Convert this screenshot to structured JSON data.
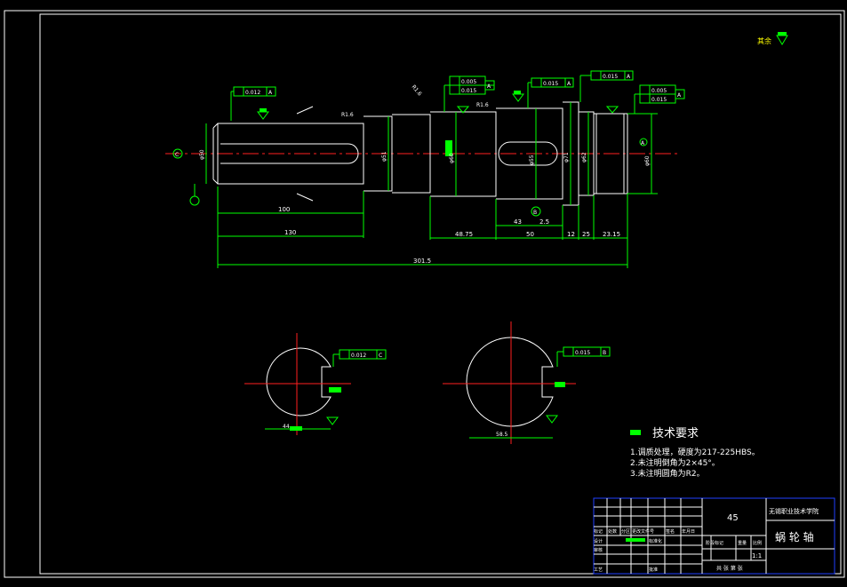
{
  "drawing": {
    "surface_finish_note": "其余",
    "dimensions": {
      "d_100": "100",
      "d_130": "130",
      "d_301_5": "301.5",
      "d_48_75": "48.75",
      "d_50": "50",
      "d_12": "12",
      "d_25_a": "25",
      "d_23_15": "23.15",
      "d_43": "43",
      "d_2_5": "2.5",
      "dia_50": "φ50",
      "dia_51": "φ51",
      "dia_60": "φ60",
      "dia_55": "φ55",
      "dia_71": "φ71",
      "dia_62": "φ62",
      "dia_60b": "φ60",
      "chamfer_1": "R1.6",
      "chamfer_2": "R1.6",
      "chamfer_3": "R1.6",
      "sec1_width": "44",
      "sec2_width": "58.5"
    },
    "tolerances": {
      "fcf1": "0.012",
      "fcf1_datum": "A",
      "fcf2a": "0.005",
      "fcf2b": "0.015",
      "fcf2_datum": "A",
      "fcf3": "0.015",
      "fcf3_datum": "A",
      "fcf4": "0.015",
      "fcf4_datum": "A",
      "fcf5a": "0.005",
      "fcf5b": "0.015",
      "fcf5_datum": "A",
      "sec1_fcf": "0.012",
      "sec1_datum": "C",
      "sec2_fcf": "0.015",
      "sec2_datum": "B"
    },
    "datum_labels": {
      "a": "A",
      "b": "B",
      "c": "C"
    }
  },
  "tech_req": {
    "title": "技术要求",
    "items": [
      "1.调质处理，硬度为217-225HBS。",
      "2.未注明倒角为2×45°。",
      "3.未注明圆角为R2。"
    ]
  },
  "title_block": {
    "material": "45",
    "school": "无锡职业技术学院",
    "part_name": "蜗 轮 轴",
    "scale": "1:1",
    "row_labels": [
      "标记",
      "设计",
      "审核",
      "工艺"
    ],
    "col_labels": [
      "处数",
      "分区",
      "更改文件号",
      "签名",
      "年月日"
    ],
    "std_label": "标准化",
    "approve_label": "批准",
    "stage_labels": [
      "阶段标记",
      "重量",
      "比例"
    ],
    "sheet_label": "共 张 第 张"
  }
}
